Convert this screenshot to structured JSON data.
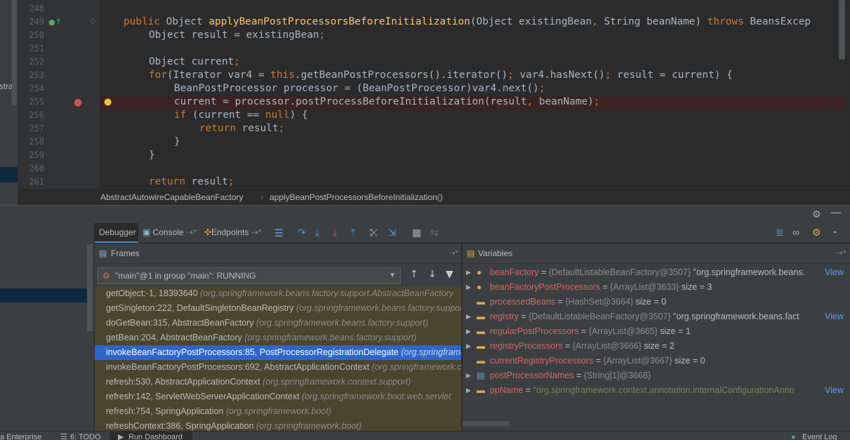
{
  "sidebar": {
    "vertical_text": "istra"
  },
  "editor": {
    "lines": [
      {
        "num": "248",
        "text": ""
      },
      {
        "num": "249",
        "text": "    public Object applyBeanPostProcessorsBeforeInitialization(Object existingBean, String beanName) throws BeansException"
      },
      {
        "num": "250",
        "text": "        Object result = existingBean;"
      },
      {
        "num": "251",
        "text": ""
      },
      {
        "num": "252",
        "text": "        Object current;"
      },
      {
        "num": "253",
        "text": "        for(Iterator var4 = this.getBeanPostProcessors().iterator(); var4.hasNext(); result = current) {"
      },
      {
        "num": "254",
        "text": "            BeanPostProcessor processor = (BeanPostProcessor)var4.next();"
      },
      {
        "num": "255",
        "text": "            current = processor.postProcessBeforeInitialization(result, beanName);"
      },
      {
        "num": "256",
        "text": "            if (current == null) {"
      },
      {
        "num": "257",
        "text": "                return result;"
      },
      {
        "num": "258",
        "text": "            }"
      },
      {
        "num": "259",
        "text": "        }"
      },
      {
        "num": "260",
        "text": ""
      },
      {
        "num": "261",
        "text": "        return result;"
      }
    ]
  },
  "breadcrumb": {
    "class": "AbstractAutowireCapableBeanFactory",
    "method": "applyBeanPostProcessorsBeforeInitialization()"
  },
  "tabs": {
    "debugger": "Debugger",
    "console": "Console",
    "endpoints": "Endpoints"
  },
  "frames": {
    "title": "Frames",
    "thread": "\"main\"@1 in group \"main\": RUNNING",
    "items": [
      {
        "method": "getObject:-1, 18393640 ",
        "pkg": "(org.springframework.beans.factory.support.AbstractBeanFactory"
      },
      {
        "method": "getSingleton:222, DefaultSingletonBeanRegistry ",
        "pkg": "(org.springframework.beans.factory.support"
      },
      {
        "method": "doGetBean:315, AbstractBeanFactory ",
        "pkg": "(org.springframework.beans.factory.support)"
      },
      {
        "method": "getBean:204, AbstractBeanFactory ",
        "pkg": "(org.springframework.beans.factory.support)"
      },
      {
        "method": "invokeBeanFactoryPostProcessors:85, PostProcessorRegistrationDelegate ",
        "pkg": "(org.springframework"
      },
      {
        "method": "invokeBeanFactoryPostProcessors:692, AbstractApplicationContext ",
        "pkg": "(org.springframework.context"
      },
      {
        "method": "refresh:530, AbstractApplicationContext ",
        "pkg": "(org.springframework.context.support)"
      },
      {
        "method": "refresh:142, ServletWebServerApplicationContext ",
        "pkg": "(org.springframework.boot.web.servlet"
      },
      {
        "method": "refresh:754, SpringApplication ",
        "pkg": "(org.springframework.boot)"
      },
      {
        "method": "refreshContext:386, SpringApplication ",
        "pkg": "(org.springframework.boot)"
      }
    ]
  },
  "variables": {
    "title": "Variables",
    "items": [
      {
        "name": "beanFactory",
        "type": "{DefaultListableBeanFactory@3507}",
        "value": " \"org.springframework.beans.",
        "link": "View",
        "icon": "field-protected-icon",
        "expandable": true
      },
      {
        "name": "beanFactoryPostProcessors",
        "type": "{ArrayList@3633}",
        "value": "  size = 3",
        "link": "",
        "icon": "field-protected-icon",
        "expandable": true
      },
      {
        "name": "processedBeans",
        "type": "{HashSet@3664}",
        "value": "  size = 0",
        "link": "",
        "icon": "local-var-icon",
        "expandable": false
      },
      {
        "name": "registry",
        "type": "{DefaultListableBeanFactory@3507}",
        "value": " \"org.springframework.beans.fact",
        "link": "View",
        "icon": "local-var-icon",
        "expandable": true
      },
      {
        "name": "regularPostProcessors",
        "type": "{ArrayList@3665}",
        "value": "  size = 1",
        "link": "",
        "icon": "local-var-icon",
        "expandable": true
      },
      {
        "name": "registryProcessors",
        "type": "{ArrayList@3666}",
        "value": "  size = 2",
        "link": "",
        "icon": "local-var-icon",
        "expandable": true
      },
      {
        "name": "currentRegistryProcessors",
        "type": "{ArrayList@3667}",
        "value": "  size = 0",
        "link": "",
        "icon": "local-var-icon",
        "expandable": false
      },
      {
        "name": "postProcessorNames",
        "type": "{String[1]@3668}",
        "value": "",
        "link": "",
        "icon": "array-icon",
        "expandable": true
      },
      {
        "name": "ppName",
        "type": "",
        "value": "\"org.springframework.context.annotation.internalConfigurationAnno",
        "link": "View",
        "icon": "local-var-icon",
        "expandable": true,
        "string": true
      }
    ]
  },
  "status": {
    "enterprise": "a Enterprise",
    "todo": "6: TODO",
    "run_dashboard": "Run Dashboard",
    "event_log": "Event Log"
  },
  "colors": {
    "accent": "#2f65ca",
    "breakpoint": "#c75450",
    "keyword": "#cc7832"
  }
}
